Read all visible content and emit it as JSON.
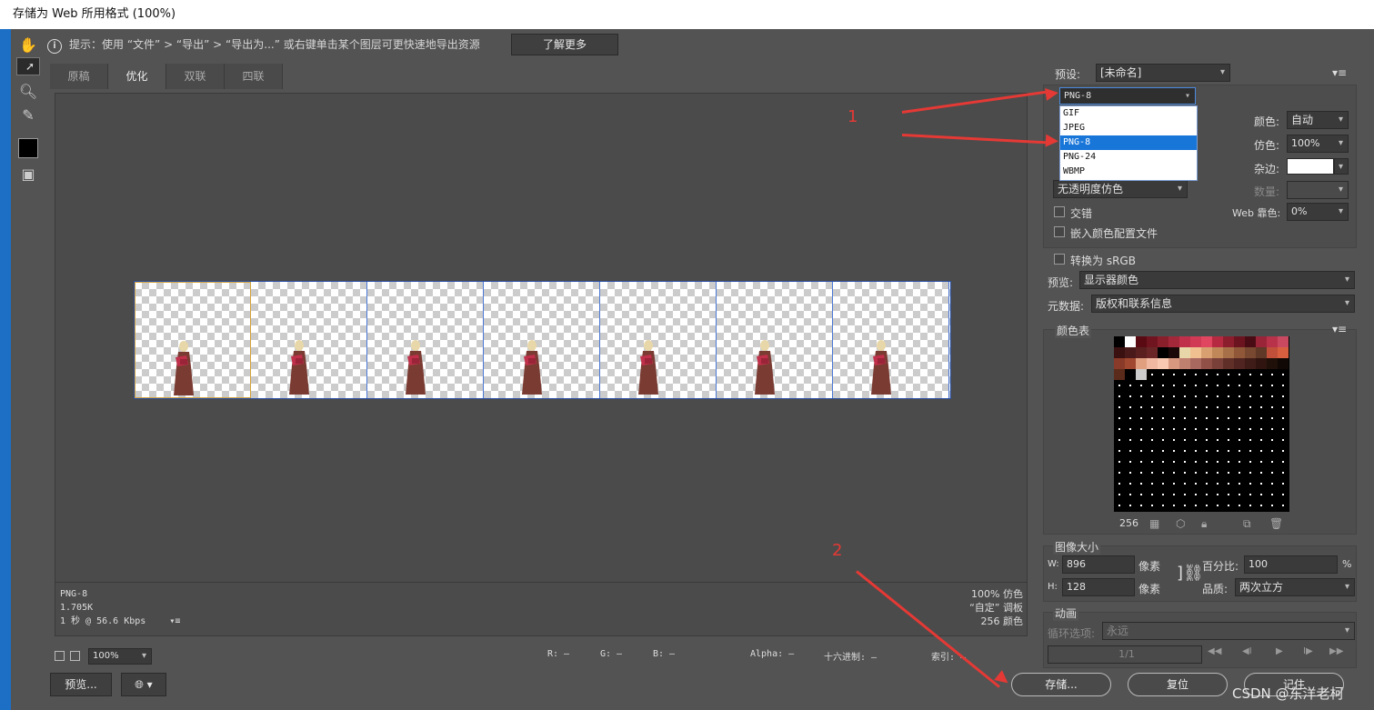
{
  "window": {
    "title": "存储为 Web 所用格式 (100%)"
  },
  "tip": {
    "text": "提示：使用 “文件” > “导出” > “导出为...” 或右键单击某个图层可更快速地导出资源",
    "learn_more": "了解更多"
  },
  "tabs": [
    "原稿",
    "优化",
    "双联",
    "四联"
  ],
  "active_tab": "优化",
  "preview_info": {
    "format": "PNG-8",
    "size": "1.705K",
    "speed": "1 秒 @ 56.6 Kbps",
    "dither": "100% 仿色",
    "palette": "“自定” 调板",
    "colors": "256 颜色"
  },
  "status": {
    "zoom": "100%",
    "r": "R: —",
    "g": "G: —",
    "b": "B: —",
    "alpha": "Alpha: —",
    "hex": "十六进制: —",
    "index": "索引: —"
  },
  "bottom": {
    "preview_btn": "预览...",
    "save_btn": "存储...",
    "reset_btn": "复位",
    "remember_btn": "记住"
  },
  "right": {
    "preset_label": "预设:",
    "preset_value": "[未命名]",
    "format_value": "PNG-8",
    "format_options": [
      "GIF",
      "JPEG",
      "PNG-8",
      "PNG-24",
      "WBMP"
    ],
    "format_selected": "PNG-8",
    "colors_label": "颜色:",
    "colors_value": "自动",
    "dither_label": "仿色:",
    "dither_value": "100%",
    "matte_label": "杂边:",
    "amount_label": "数量:",
    "transparency_dither": "无透明度仿色",
    "interlaced": "交错",
    "web_snap_label": "Web 靠色:",
    "web_snap_value": "0%",
    "embed_profile": "嵌入颜色配置文件",
    "convert_srgb": "转换为 sRGB",
    "preview_label": "预览:",
    "preview_value": "显示器颜色",
    "metadata_label": "元数据:",
    "metadata_value": "版权和联系信息",
    "color_table_label": "颜色表",
    "color_count": "256",
    "image_size_label": "图像大小",
    "w_label": "W:",
    "w_value": "896",
    "h_label": "H:",
    "h_value": "128",
    "px": "像素",
    "percent_label": "百分比:",
    "percent_value": "100",
    "percent_sign": "%",
    "quality_label": "品质:",
    "quality_value": "两次立方",
    "animation_label": "动画",
    "loop_label": "循环选项:",
    "loop_value": "永远",
    "frame_counter": "1/1"
  },
  "annotations": {
    "one": "1",
    "two": "2"
  },
  "watermark": "CSDN @东洋老柯"
}
